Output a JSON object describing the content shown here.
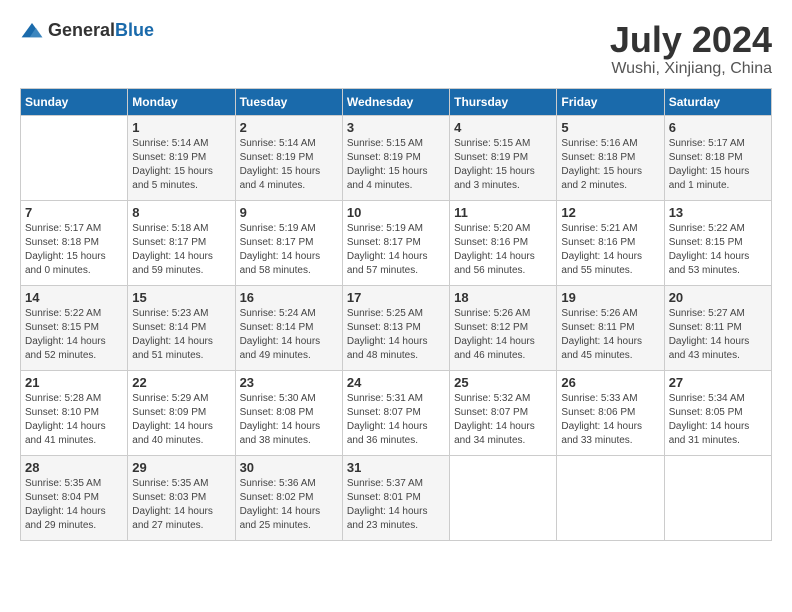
{
  "header": {
    "logo_general": "General",
    "logo_blue": "Blue",
    "month": "July 2024",
    "location": "Wushi, Xinjiang, China"
  },
  "weekdays": [
    "Sunday",
    "Monday",
    "Tuesday",
    "Wednesday",
    "Thursday",
    "Friday",
    "Saturday"
  ],
  "weeks": [
    [
      {
        "day": "",
        "info": ""
      },
      {
        "day": "1",
        "info": "Sunrise: 5:14 AM\nSunset: 8:19 PM\nDaylight: 15 hours\nand 5 minutes."
      },
      {
        "day": "2",
        "info": "Sunrise: 5:14 AM\nSunset: 8:19 PM\nDaylight: 15 hours\nand 4 minutes."
      },
      {
        "day": "3",
        "info": "Sunrise: 5:15 AM\nSunset: 8:19 PM\nDaylight: 15 hours\nand 4 minutes."
      },
      {
        "day": "4",
        "info": "Sunrise: 5:15 AM\nSunset: 8:19 PM\nDaylight: 15 hours\nand 3 minutes."
      },
      {
        "day": "5",
        "info": "Sunrise: 5:16 AM\nSunset: 8:18 PM\nDaylight: 15 hours\nand 2 minutes."
      },
      {
        "day": "6",
        "info": "Sunrise: 5:17 AM\nSunset: 8:18 PM\nDaylight: 15 hours\nand 1 minute."
      }
    ],
    [
      {
        "day": "7",
        "info": "Sunrise: 5:17 AM\nSunset: 8:18 PM\nDaylight: 15 hours\nand 0 minutes."
      },
      {
        "day": "8",
        "info": "Sunrise: 5:18 AM\nSunset: 8:17 PM\nDaylight: 14 hours\nand 59 minutes."
      },
      {
        "day": "9",
        "info": "Sunrise: 5:19 AM\nSunset: 8:17 PM\nDaylight: 14 hours\nand 58 minutes."
      },
      {
        "day": "10",
        "info": "Sunrise: 5:19 AM\nSunset: 8:17 PM\nDaylight: 14 hours\nand 57 minutes."
      },
      {
        "day": "11",
        "info": "Sunrise: 5:20 AM\nSunset: 8:16 PM\nDaylight: 14 hours\nand 56 minutes."
      },
      {
        "day": "12",
        "info": "Sunrise: 5:21 AM\nSunset: 8:16 PM\nDaylight: 14 hours\nand 55 minutes."
      },
      {
        "day": "13",
        "info": "Sunrise: 5:22 AM\nSunset: 8:15 PM\nDaylight: 14 hours\nand 53 minutes."
      }
    ],
    [
      {
        "day": "14",
        "info": "Sunrise: 5:22 AM\nSunset: 8:15 PM\nDaylight: 14 hours\nand 52 minutes."
      },
      {
        "day": "15",
        "info": "Sunrise: 5:23 AM\nSunset: 8:14 PM\nDaylight: 14 hours\nand 51 minutes."
      },
      {
        "day": "16",
        "info": "Sunrise: 5:24 AM\nSunset: 8:14 PM\nDaylight: 14 hours\nand 49 minutes."
      },
      {
        "day": "17",
        "info": "Sunrise: 5:25 AM\nSunset: 8:13 PM\nDaylight: 14 hours\nand 48 minutes."
      },
      {
        "day": "18",
        "info": "Sunrise: 5:26 AM\nSunset: 8:12 PM\nDaylight: 14 hours\nand 46 minutes."
      },
      {
        "day": "19",
        "info": "Sunrise: 5:26 AM\nSunset: 8:11 PM\nDaylight: 14 hours\nand 45 minutes."
      },
      {
        "day": "20",
        "info": "Sunrise: 5:27 AM\nSunset: 8:11 PM\nDaylight: 14 hours\nand 43 minutes."
      }
    ],
    [
      {
        "day": "21",
        "info": "Sunrise: 5:28 AM\nSunset: 8:10 PM\nDaylight: 14 hours\nand 41 minutes."
      },
      {
        "day": "22",
        "info": "Sunrise: 5:29 AM\nSunset: 8:09 PM\nDaylight: 14 hours\nand 40 minutes."
      },
      {
        "day": "23",
        "info": "Sunrise: 5:30 AM\nSunset: 8:08 PM\nDaylight: 14 hours\nand 38 minutes."
      },
      {
        "day": "24",
        "info": "Sunrise: 5:31 AM\nSunset: 8:07 PM\nDaylight: 14 hours\nand 36 minutes."
      },
      {
        "day": "25",
        "info": "Sunrise: 5:32 AM\nSunset: 8:07 PM\nDaylight: 14 hours\nand 34 minutes."
      },
      {
        "day": "26",
        "info": "Sunrise: 5:33 AM\nSunset: 8:06 PM\nDaylight: 14 hours\nand 33 minutes."
      },
      {
        "day": "27",
        "info": "Sunrise: 5:34 AM\nSunset: 8:05 PM\nDaylight: 14 hours\nand 31 minutes."
      }
    ],
    [
      {
        "day": "28",
        "info": "Sunrise: 5:35 AM\nSunset: 8:04 PM\nDaylight: 14 hours\nand 29 minutes."
      },
      {
        "day": "29",
        "info": "Sunrise: 5:35 AM\nSunset: 8:03 PM\nDaylight: 14 hours\nand 27 minutes."
      },
      {
        "day": "30",
        "info": "Sunrise: 5:36 AM\nSunset: 8:02 PM\nDaylight: 14 hours\nand 25 minutes."
      },
      {
        "day": "31",
        "info": "Sunrise: 5:37 AM\nSunset: 8:01 PM\nDaylight: 14 hours\nand 23 minutes."
      },
      {
        "day": "",
        "info": ""
      },
      {
        "day": "",
        "info": ""
      },
      {
        "day": "",
        "info": ""
      }
    ]
  ]
}
